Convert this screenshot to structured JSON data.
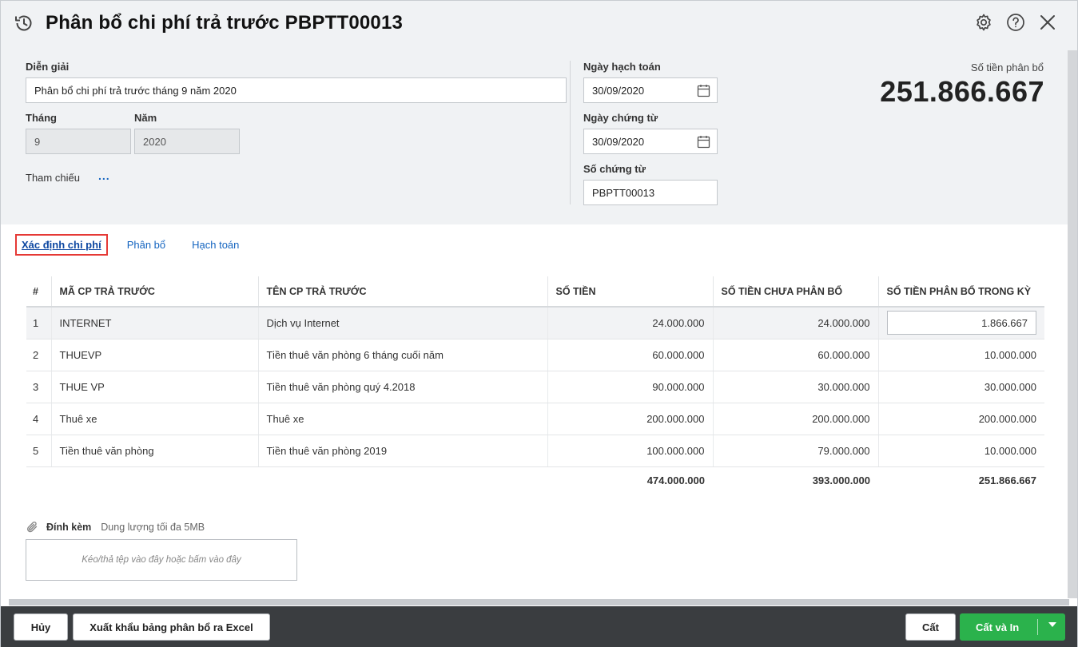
{
  "header": {
    "title": "Phân bổ chi phí trả trước PBPTT00013"
  },
  "form": {
    "dien_giai_label": "Diễn giải",
    "dien_giai_value": "Phân bổ chi phí trả trước tháng 9 năm 2020",
    "thang_label": "Tháng",
    "thang_value": "9",
    "nam_label": "Năm",
    "nam_value": "2020",
    "tham_chieu_label": "Tham chiếu",
    "tham_chieu_more": "...",
    "ngay_hach_toan_label": "Ngày hạch toán",
    "ngay_hach_toan_value": "30/09/2020",
    "ngay_chung_tu_label": "Ngày chứng từ",
    "ngay_chung_tu_value": "30/09/2020",
    "so_chung_tu_label": "Số chứng từ",
    "so_chung_tu_value": "PBPTT00013",
    "so_tien_phan_bo_label": "Số tiền phân bổ",
    "so_tien_phan_bo_value": "251.866.667"
  },
  "tabs": [
    {
      "label": "Xác định chi phí",
      "active": true
    },
    {
      "label": "Phân bổ",
      "active": false
    },
    {
      "label": "Hạch toán",
      "active": false
    }
  ],
  "table": {
    "headers": [
      "#",
      "MÃ CP TRẢ TRƯỚC",
      "TÊN CP TRẢ TRƯỚC",
      "SỐ TIỀN",
      "SỐ TIỀN CHƯA PHÂN BỔ",
      "SỐ TIỀN PHÂN BỔ TRONG KỲ"
    ],
    "rows": [
      [
        "1",
        "INTERNET",
        "Dịch vụ Internet",
        "24.000.000",
        "24.000.000",
        "1.866.667"
      ],
      [
        "2",
        "THUEVP",
        "Tiền thuê văn phòng 6 tháng cuối năm",
        "60.000.000",
        "60.000.000",
        "10.000.000"
      ],
      [
        "3",
        "THUE VP",
        "Tiền thuê văn phòng quý 4.2018",
        "90.000.000",
        "30.000.000",
        "30.000.000"
      ],
      [
        "4",
        "Thuê xe",
        "Thuê xe",
        "200.000.000",
        "200.000.000",
        "200.000.000"
      ],
      [
        "5",
        "Tiền thuê văn phòng",
        "Tiền thuê văn phòng  2019",
        "100.000.000",
        "79.000.000",
        "10.000.000"
      ]
    ],
    "totals": [
      "474.000.000",
      "393.000.000",
      "251.866.667"
    ]
  },
  "attach": {
    "label": "Đính kèm",
    "hint": "Dung lượng tối đa 5MB",
    "dropzone": "Kéo/thả tệp vào đây hoặc bấm vào đây"
  },
  "footer": {
    "cancel": "Hủy",
    "export": "Xuất khẩu bảng phân bổ ra Excel",
    "save": "Cất",
    "save_print": "Cất và In"
  },
  "colors": {
    "accent_green": "#2bb24c",
    "link_blue": "#1565c0",
    "active_tab_border": "#e53935",
    "footer_bg": "#3a3d40"
  },
  "icons": [
    "history-icon",
    "gear-icon",
    "help-icon",
    "close-icon",
    "calendar-icon",
    "paperclip-icon",
    "chevron-down-icon"
  ]
}
